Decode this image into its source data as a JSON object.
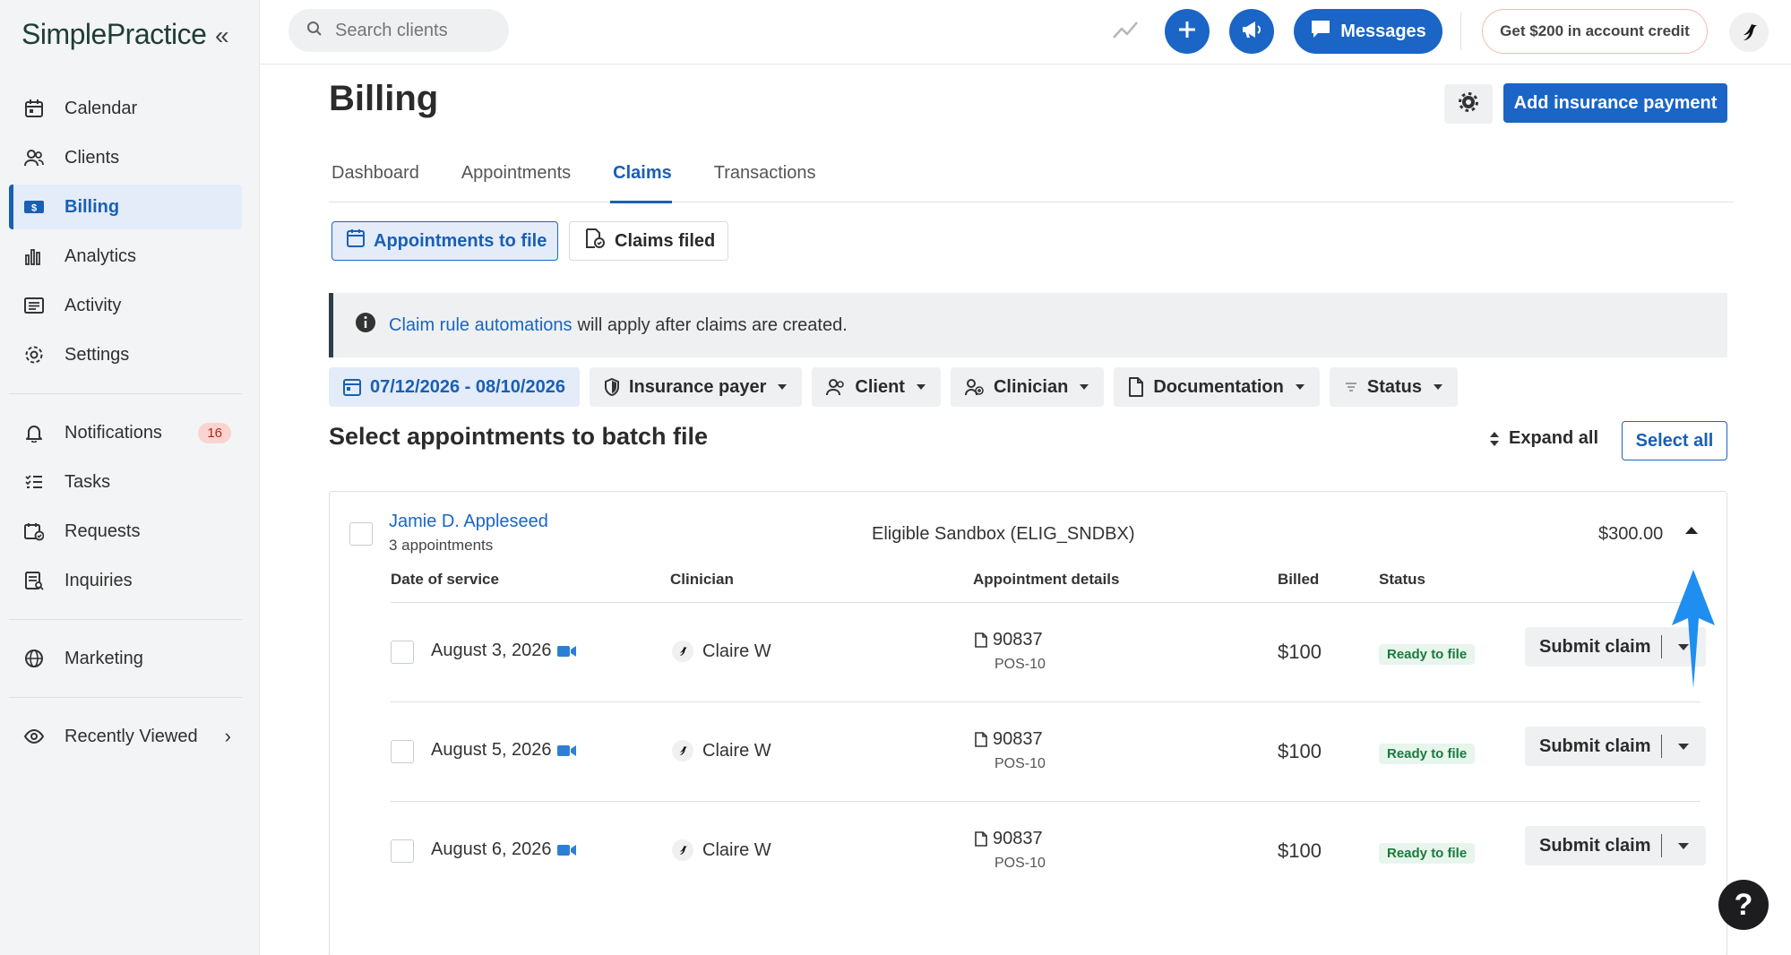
{
  "brand": "SimplePractice",
  "sidebar": {
    "items": [
      {
        "label": "Calendar"
      },
      {
        "label": "Clients"
      },
      {
        "label": "Billing"
      },
      {
        "label": "Analytics"
      },
      {
        "label": "Activity"
      },
      {
        "label": "Settings"
      },
      {
        "label": "Notifications",
        "badge": "16"
      },
      {
        "label": "Tasks"
      },
      {
        "label": "Requests"
      },
      {
        "label": "Inquiries"
      },
      {
        "label": "Marketing"
      },
      {
        "label": "Recently Viewed"
      }
    ]
  },
  "topbar": {
    "search_placeholder": "Search clients",
    "messages_label": "Messages",
    "credit_label": "Get $200 in account credit"
  },
  "page": {
    "title": "Billing",
    "add_payment_label": "Add insurance payment",
    "tabs": [
      {
        "label": "Dashboard"
      },
      {
        "label": "Appointments"
      },
      {
        "label": "Claims"
      },
      {
        "label": "Transactions"
      }
    ],
    "segments": {
      "active": "Appointments to file",
      "inactive": "Claims filed"
    },
    "info": {
      "link": "Claim rule automations",
      "text": "will apply after claims are created."
    },
    "filters": {
      "date_range": "07/12/2026 - 08/10/2026",
      "insurance_payer": "Insurance payer",
      "client": "Client",
      "clinician": "Clinician",
      "documentation": "Documentation",
      "status": "Status"
    },
    "section_title": "Select appointments to batch file",
    "expand_all": "Expand all",
    "select_all": "Select all"
  },
  "client_group": {
    "name": "Jamie D. Appleseed",
    "appointments": "3 appointments",
    "payer": "Eligible Sandbox (ELIG_SNDBX)",
    "amount": "$300.00",
    "columns": [
      "Date of service",
      "Clinician",
      "Appointment details",
      "Billed",
      "Status"
    ],
    "rows": [
      {
        "date": "August 3, 2026",
        "clinician": "Claire W",
        "code": "90837",
        "pos": "POS-10",
        "billed": "$100",
        "status": "Ready to file",
        "action": "Submit claim"
      },
      {
        "date": "August 5, 2026",
        "clinician": "Claire W",
        "code": "90837",
        "pos": "POS-10",
        "billed": "$100",
        "status": "Ready to file",
        "action": "Submit claim"
      },
      {
        "date": "August 6, 2026",
        "clinician": "Claire W",
        "code": "90837",
        "pos": "POS-10",
        "billed": "$100",
        "status": "Ready to file",
        "action": "Submit claim"
      }
    ]
  },
  "help_label": "?",
  "colors": {
    "accent": "#1a65c6",
    "status_green": "#1b7a3e",
    "annotation_arrow": "#1e8ef0"
  }
}
